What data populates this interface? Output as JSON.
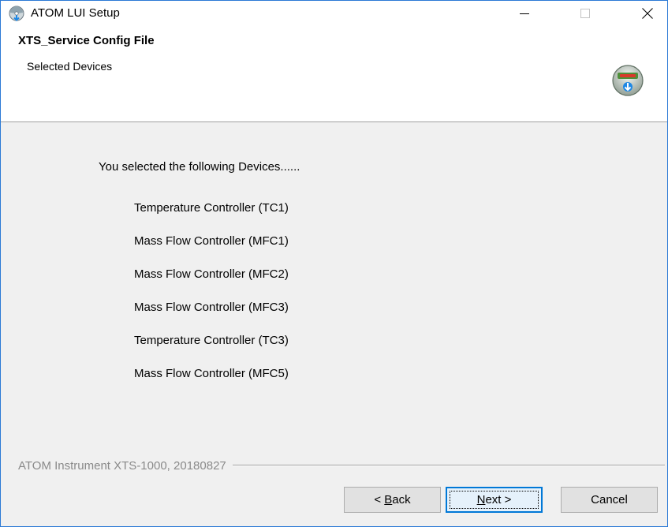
{
  "window": {
    "title": "ATOM LUI Setup",
    "icon": "setup-disc-icon"
  },
  "titlebar": {
    "minimize_icon": "minimize-icon",
    "maximize_icon": "maximize-icon",
    "close_icon": "close-icon"
  },
  "header": {
    "title": "XTS_Service Config File",
    "subtitle": "Selected Devices",
    "logo_icon": "installer-logo-icon"
  },
  "content": {
    "intro": "You selected the following Devices......",
    "devices": [
      "Temperature Controller (TC1)",
      "Mass Flow Controller (MFC1)",
      "Mass Flow Controller (MFC2)",
      "Mass Flow Controller (MFC3)",
      "Temperature Controller (TC3)",
      "Mass Flow Controller (MFC5)"
    ]
  },
  "branding": {
    "text": "ATOM Instrument XTS-1000, 20180827"
  },
  "buttons": {
    "back_prefix": "< ",
    "back_mnemonic": "B",
    "back_rest": "ack",
    "next_mnemonic": "N",
    "next_rest": "ext >",
    "cancel": "Cancel"
  },
  "colors": {
    "accent": "#0078d7",
    "window_border": "#2b79d6",
    "dialog_bg": "#f0f0f0",
    "branding_text": "#8a8a8a"
  }
}
